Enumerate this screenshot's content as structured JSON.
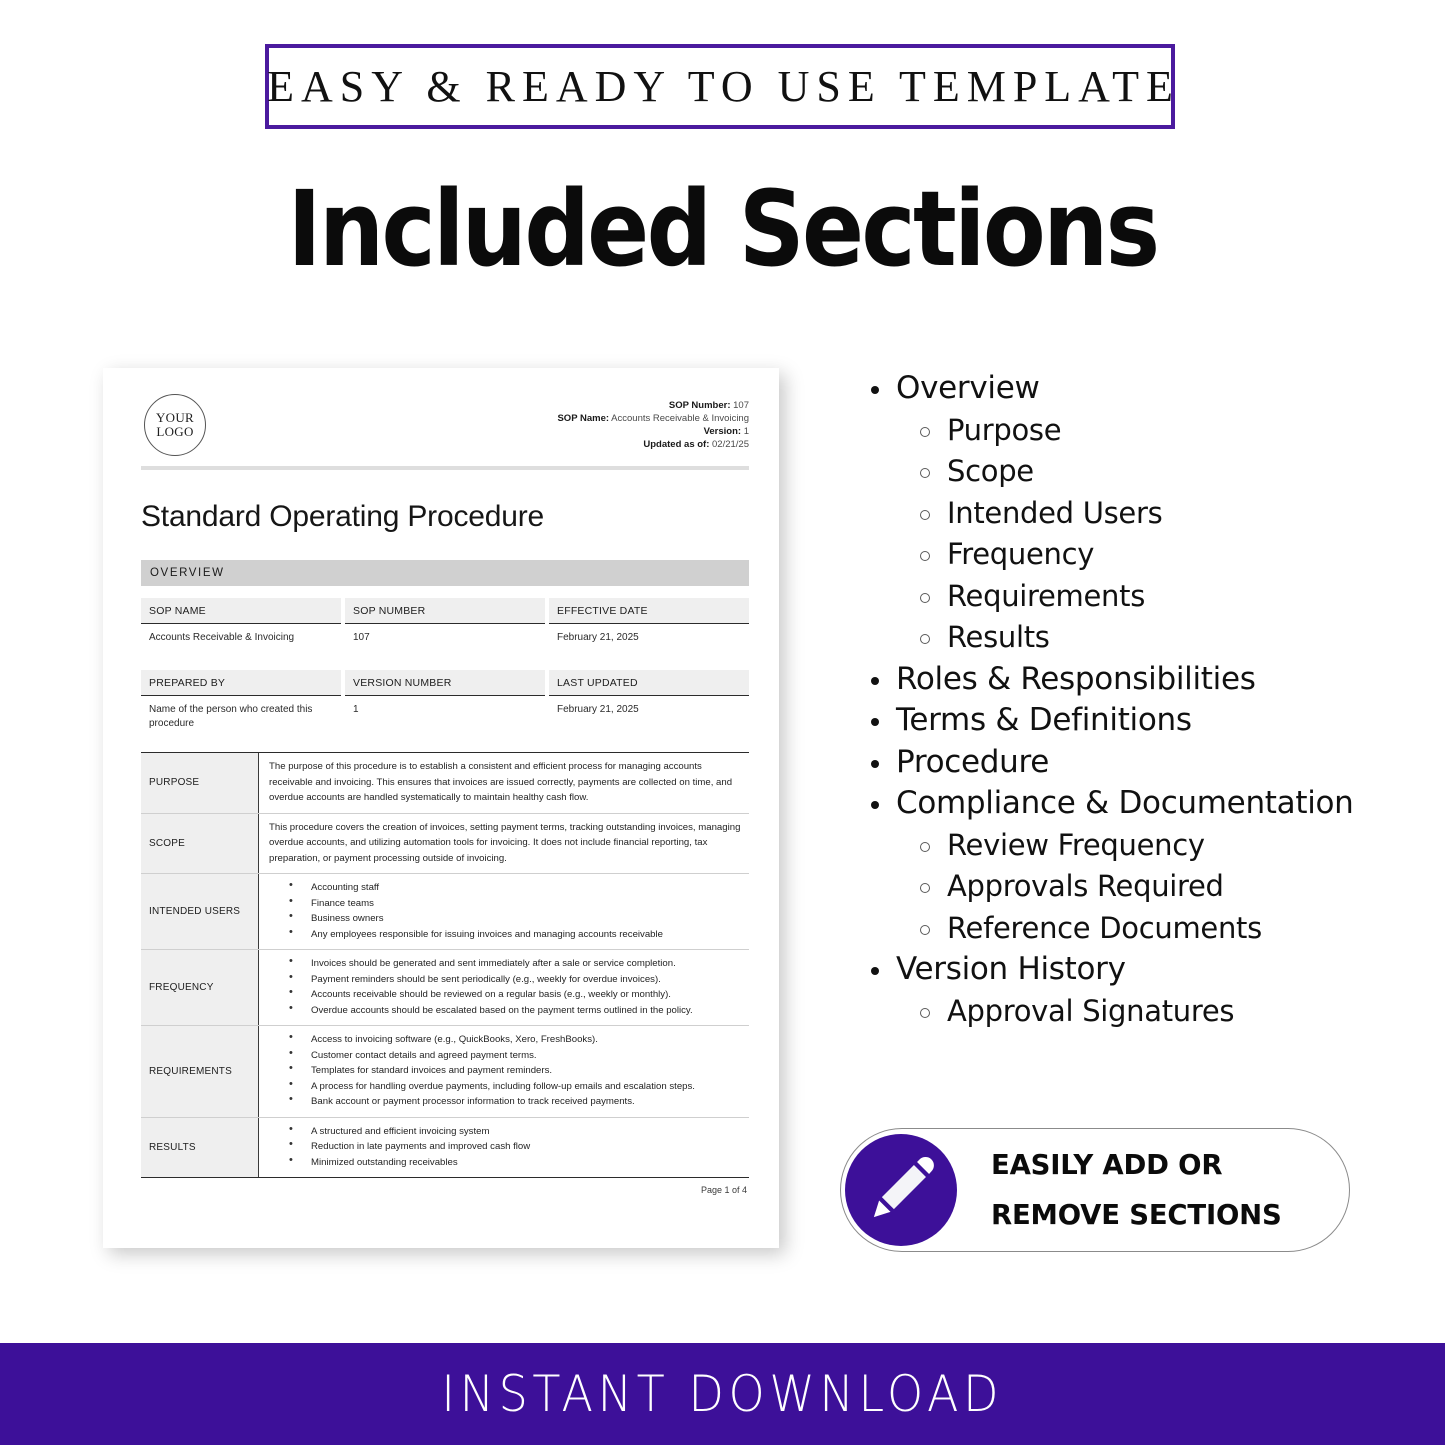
{
  "top_banner": {
    "text": "EASY & READY TO USE TEMPLATE",
    "border_color": "#4B1A9E"
  },
  "main_title": "Included Sections",
  "brand": {
    "purple": "#3D1099",
    "accent_purple": "#4B1A9E"
  },
  "document": {
    "logo": {
      "line1": "YOUR",
      "line2": "LOGO"
    },
    "meta": {
      "sop_number_label": "SOP Number:",
      "sop_number_value": "107",
      "sop_name_label": "SOP Name:",
      "sop_name_value": "Accounts Receivable & Invoicing",
      "version_label": "Version:",
      "version_value": "1",
      "updated_label": "Updated as of:",
      "updated_value": "02/21/25"
    },
    "title": "Standard Operating Procedure",
    "section_bar": "OVERVIEW",
    "meta_table_1": [
      {
        "label": "SOP NAME",
        "value": "Accounts Receivable & Invoicing"
      },
      {
        "label": "SOP NUMBER",
        "value": "107"
      },
      {
        "label": "EFFECTIVE DATE",
        "value": "February 21, 2025"
      }
    ],
    "meta_table_2": [
      {
        "label": "PREPARED BY",
        "value": "Name of the person who created this procedure"
      },
      {
        "label": "VERSION NUMBER",
        "value": "1"
      },
      {
        "label": "LAST UPDATED",
        "value": "February 21, 2025"
      }
    ],
    "rows": {
      "purpose": {
        "label": "PURPOSE",
        "text": "The purpose of this procedure is to establish a consistent and efficient process for managing accounts receivable and invoicing. This ensures that invoices are issued correctly, payments are collected on time, and overdue accounts are handled systematically to maintain healthy cash flow."
      },
      "scope": {
        "label": "SCOPE",
        "text": "This procedure covers the creation of invoices, setting payment terms, tracking outstanding invoices, managing overdue accounts, and utilizing automation tools for invoicing. It does not include financial reporting, tax preparation, or payment processing outside of invoicing."
      },
      "intended_users": {
        "label": "INTENDED USERS",
        "items": [
          "Accounting staff",
          "Finance teams",
          "Business owners",
          "Any employees responsible for issuing invoices and managing accounts receivable"
        ]
      },
      "frequency": {
        "label": "FREQUENCY",
        "items": [
          "Invoices should be generated and sent immediately after a sale or service completion.",
          "Payment reminders should be sent periodically (e.g., weekly for overdue invoices).",
          "Accounts receivable should be reviewed on a regular basis (e.g., weekly or monthly).",
          "Overdue accounts should be escalated based on the payment terms outlined in the policy."
        ]
      },
      "requirements": {
        "label": "REQUIREMENTS",
        "items": [
          "Access to invoicing software (e.g., QuickBooks, Xero, FreshBooks).",
          "Customer contact details and agreed payment terms.",
          "Templates for standard invoices and payment reminders.",
          "A process for handling overdue payments, including follow-up emails and escalation steps.",
          "Bank account or payment processor information to track received payments."
        ]
      },
      "results": {
        "label": "RESULTS",
        "items": [
          "A structured and efficient invoicing system",
          "Reduction in late payments and improved cash flow",
          "Minimized outstanding receivables"
        ]
      }
    },
    "footer": "Page 1 of 4"
  },
  "sections_list": [
    {
      "level": 1,
      "label": "Overview"
    },
    {
      "level": 2,
      "label": "Purpose"
    },
    {
      "level": 2,
      "label": "Scope"
    },
    {
      "level": 2,
      "label": "Intended Users"
    },
    {
      "level": 2,
      "label": "Frequency"
    },
    {
      "level": 2,
      "label": "Requirements"
    },
    {
      "level": 2,
      "label": "Results"
    },
    {
      "level": 1,
      "label": "Roles & Responsibilities"
    },
    {
      "level": 1,
      "label": "Terms & Definitions"
    },
    {
      "level": 1,
      "label": "Procedure"
    },
    {
      "level": 1,
      "label": "Compliance & Documentation"
    },
    {
      "level": 2,
      "label": "Review Frequency"
    },
    {
      "level": 2,
      "label": "Approvals Required"
    },
    {
      "level": 2,
      "label": "Reference Documents"
    },
    {
      "level": 1,
      "label": "Version History"
    },
    {
      "level": 2,
      "label": "Approval Signatures"
    }
  ],
  "pill": {
    "line1": "EASILY ADD OR",
    "line2": "REMOVE SECTIONS",
    "icon": "pencil-icon"
  },
  "bottom_bar": {
    "text": "INSTANT DOWNLOAD"
  }
}
